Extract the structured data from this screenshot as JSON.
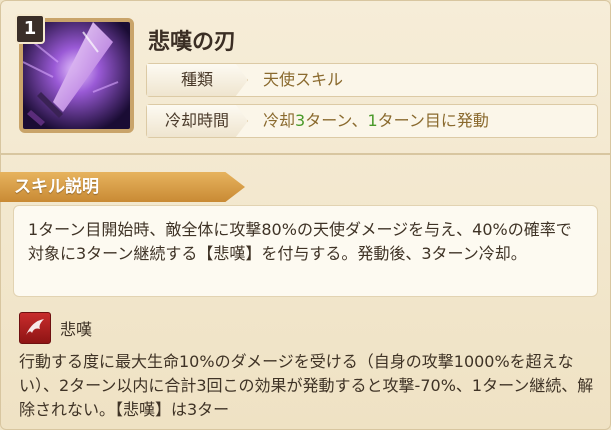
{
  "skill": {
    "level": "1",
    "name": "悲嘆の刃",
    "type_label": "種類",
    "type_value": "天使スキル",
    "cooldown_label": "冷却時間",
    "cooldown_parts": [
      "冷却",
      "3",
      "ターン、",
      "1",
      "ターン目に発動"
    ]
  },
  "section": {
    "title": "スキル説明",
    "description": "1ターン目開始時、敵全体に攻撃80%の天使ダメージを与え、40%の確率で対象に3ターン継続する【悲嘆】を付与する。発動後、3ターン冷却。"
  },
  "effect": {
    "name": "悲嘆",
    "description": "行動する度に最大生命10%のダメージを受ける（自身の攻撃1000%を超えない）、2ターン以内に合計3回この効果が発動すると攻撃-70%、1ターン継続、解除されない。【悲嘆】は3ター"
  },
  "colors": {
    "accent_green": "#4a9a2a",
    "value_gold": "#8a6a2e",
    "header_orange": "#d99a42",
    "effect_red": "#c82c2c"
  },
  "icons": {
    "skill": "purple-sword-icon",
    "effect": "red-wing-icon"
  }
}
